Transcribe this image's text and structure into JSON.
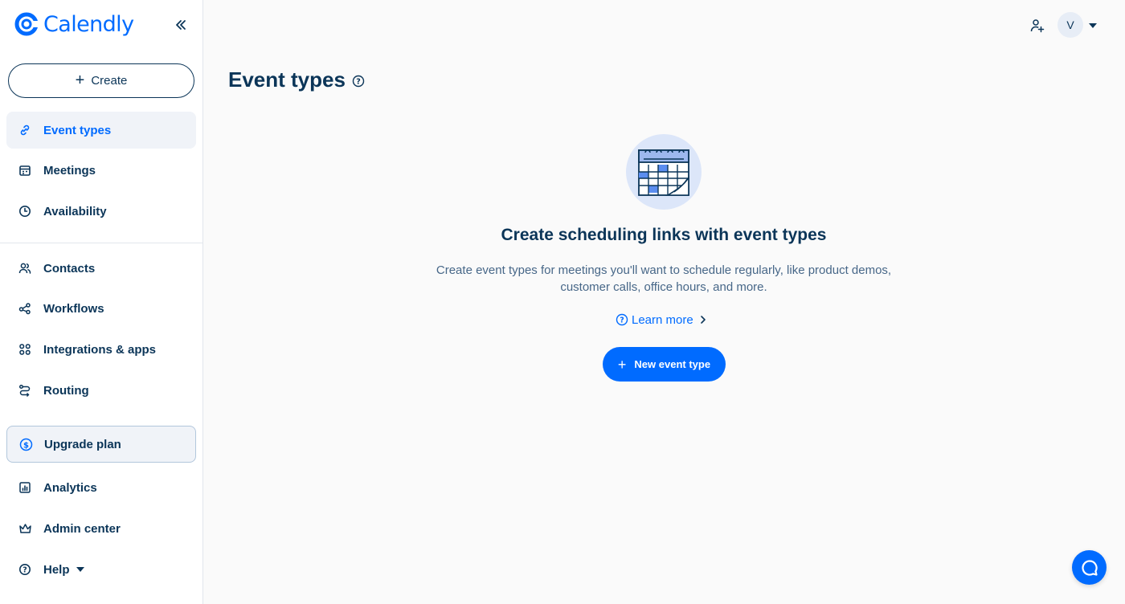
{
  "brand": {
    "name": "Calendly",
    "color": "#006bff"
  },
  "sidebar": {
    "create_label": "Create",
    "items": [
      {
        "label": "Event types",
        "icon": "link-icon",
        "active": true
      },
      {
        "label": "Meetings",
        "icon": "calendar-icon"
      },
      {
        "label": "Availability",
        "icon": "clock-icon"
      },
      {
        "label": "Contacts",
        "icon": "contacts-icon"
      },
      {
        "label": "Workflows",
        "icon": "workflow-icon"
      },
      {
        "label": "Integrations & apps",
        "icon": "grid-icon"
      },
      {
        "label": "Routing",
        "icon": "routing-icon"
      },
      {
        "label": "Upgrade plan",
        "icon": "dollar-icon"
      },
      {
        "label": "Analytics",
        "icon": "analytics-icon"
      },
      {
        "label": "Admin center",
        "icon": "crown-icon"
      },
      {
        "label": "Help",
        "icon": "help-icon"
      }
    ]
  },
  "topbar": {
    "avatar_initial": "V"
  },
  "main": {
    "title": "Event types",
    "empty_state": {
      "title": "Create scheduling links with event types",
      "description": "Create event types for meetings you'll want to schedule regularly, like product demos, customer calls, office hours, and more.",
      "learn_more": "Learn more",
      "primary_button": "New event type"
    }
  }
}
